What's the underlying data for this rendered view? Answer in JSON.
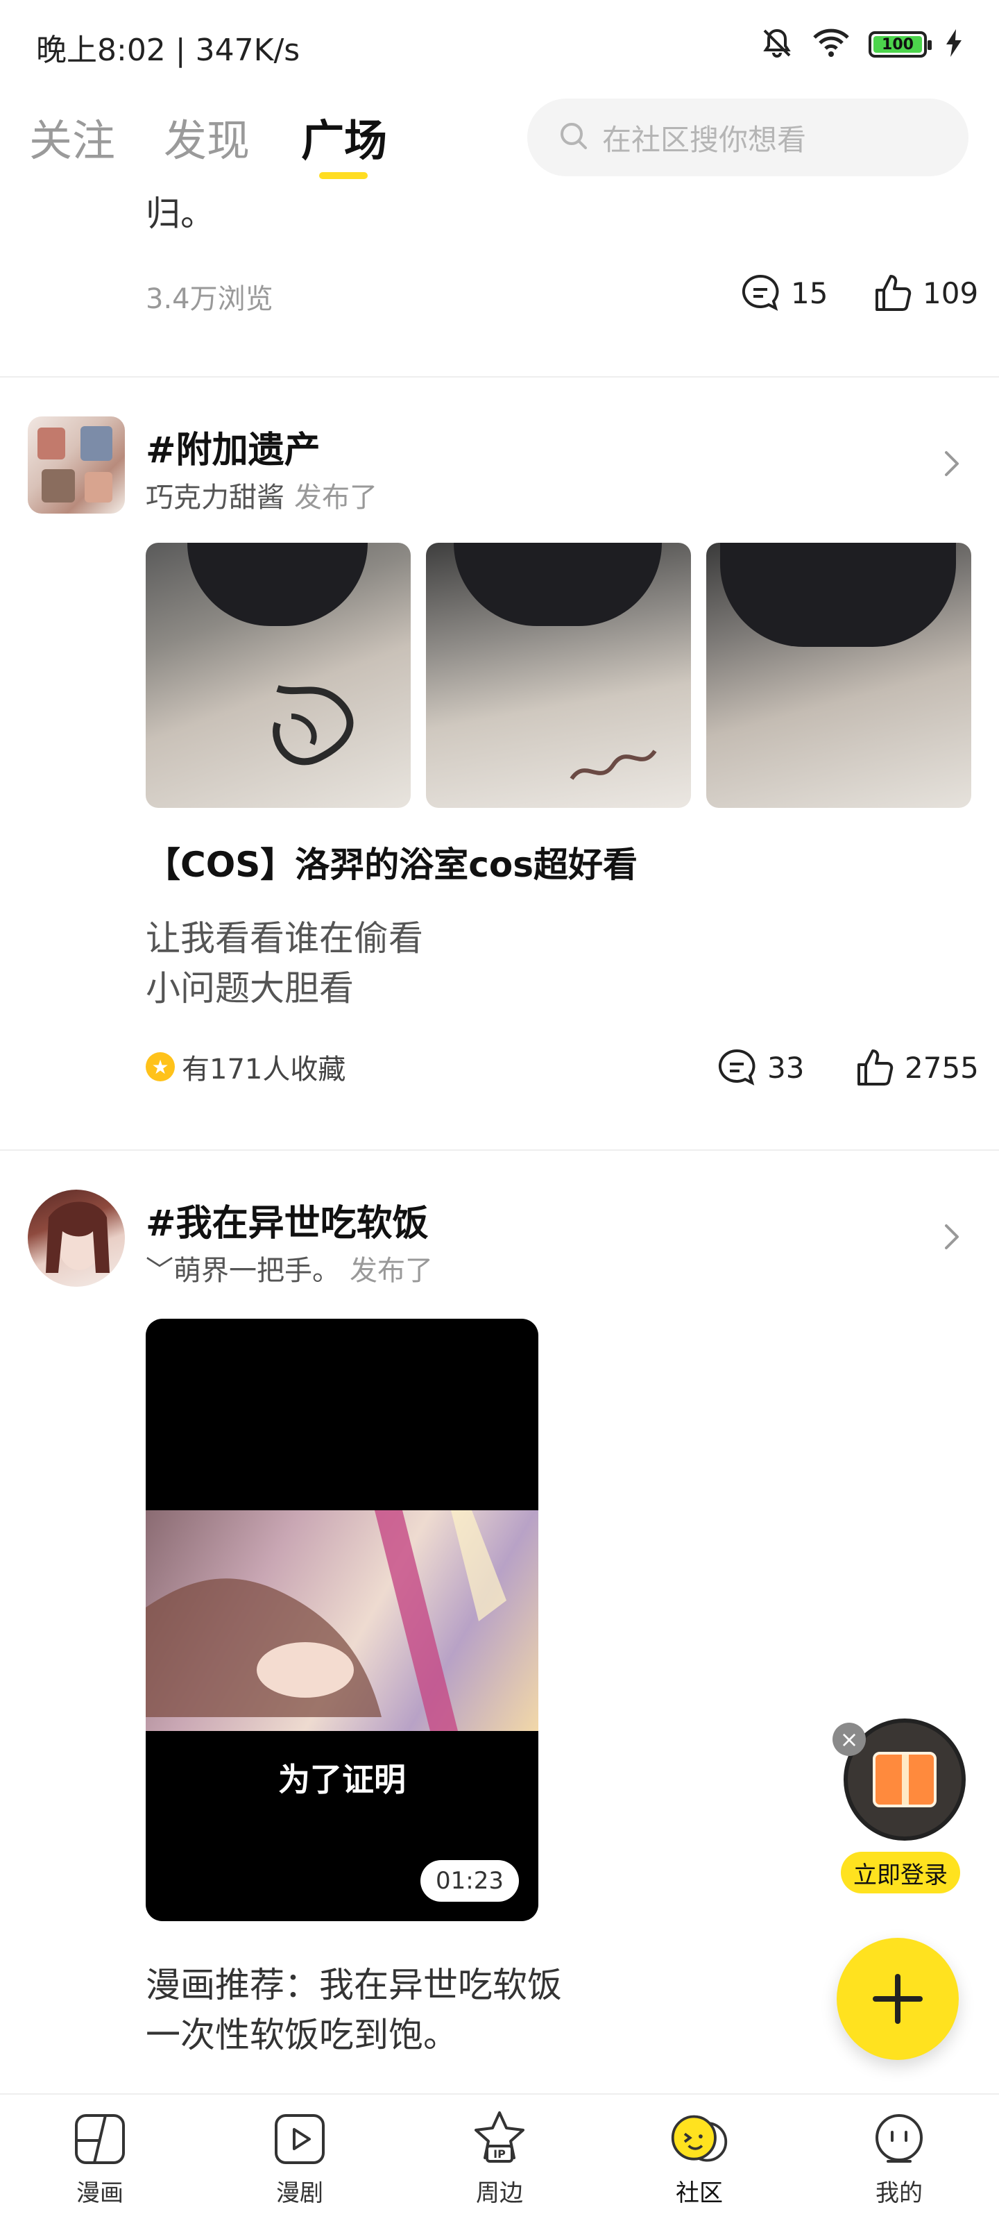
{
  "status": {
    "time": "晚上8:02 | 347K/s",
    "battery": "100"
  },
  "topnav": {
    "tabs": [
      {
        "label": "关注"
      },
      {
        "label": "发现"
      },
      {
        "label": "广场"
      }
    ],
    "active_tab": "广场",
    "search_placeholder": "在社区搜你想看"
  },
  "posts": [
    {
      "tail_text": "归。",
      "views": "3.4万浏览",
      "comments": "15",
      "likes": "109"
    },
    {
      "topic": "#附加遗产",
      "author": "巧克力甜酱",
      "published": "发布了",
      "title": "【COS】洛羿的浴室cos超好看",
      "body_lines": [
        "让我看看谁在偷看",
        "小问题大胆看"
      ],
      "favorites": "有171人收藏",
      "comments": "33",
      "likes": "2755"
    },
    {
      "topic": "#我在异世吃软饭",
      "author": "﹀萌界一把手。",
      "published": "发布了",
      "video_caption": "为了证明",
      "video_duration": "01:23",
      "body_lines": [
        "漫画推荐：我在异世吃软饭",
        "一次性软饭吃到饱。"
      ]
    }
  ],
  "gift": {
    "label": "立即登录"
  },
  "bottomnav": {
    "items": [
      {
        "label": "漫画",
        "icon": "comic-icon"
      },
      {
        "label": "漫剧",
        "icon": "play-icon"
      },
      {
        "label": "周边",
        "icon": "ip-star-icon"
      },
      {
        "label": "社区",
        "icon": "community-face-icon"
      },
      {
        "label": "我的",
        "icon": "profile-face-icon"
      }
    ],
    "active": "社区"
  },
  "colors": {
    "accent": "#ffe21f",
    "tab_underline": "#ffdd22",
    "muted_text": "#999999"
  }
}
